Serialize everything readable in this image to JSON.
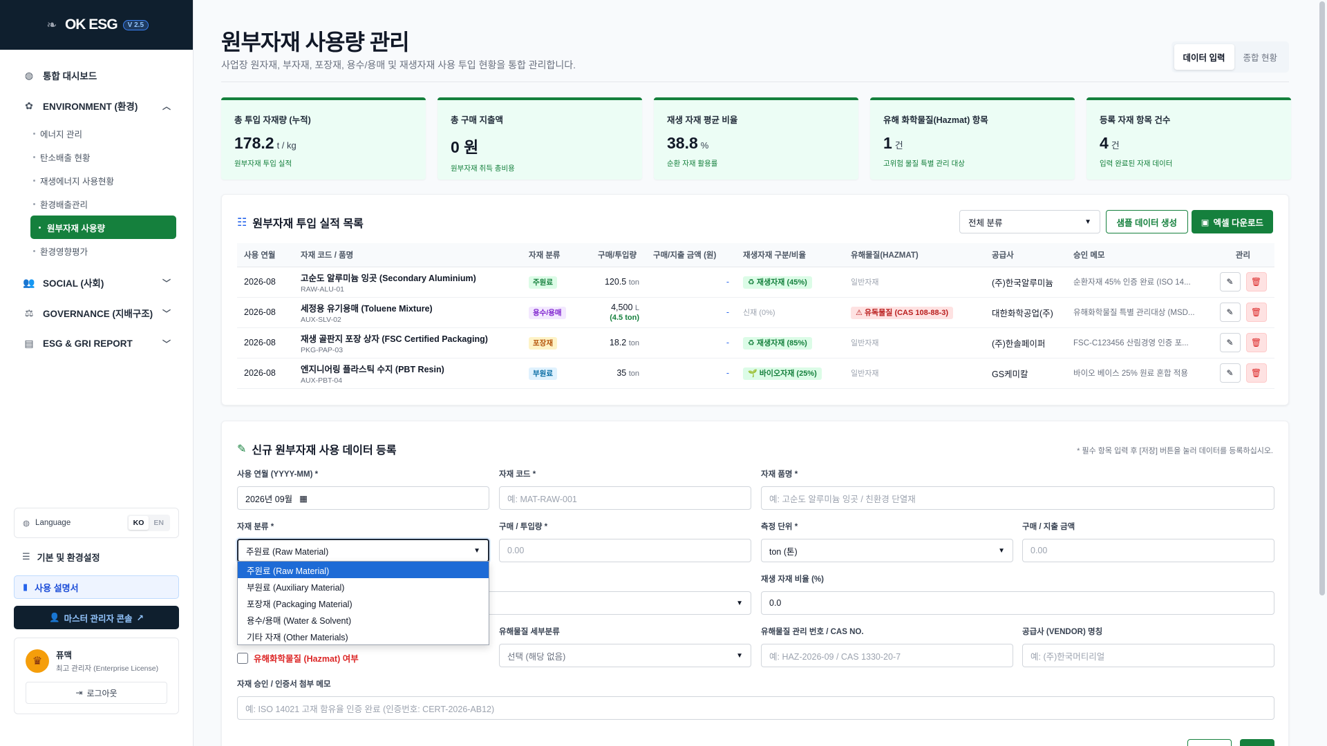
{
  "app": {
    "name": "OK ESG",
    "version": "V 2.5"
  },
  "sidebar": {
    "dashboard": "통합 대시보드",
    "env": {
      "label": "ENVIRONMENT (환경)",
      "items": [
        "에너지 관리",
        "탄소배출 현황",
        "재생에너지 사용현황",
        "환경배출관리",
        "원부자재 사용량",
        "환경영향평가"
      ],
      "active": "원부자재 사용량"
    },
    "social": "SOCIAL (사회)",
    "governance": "GOVERNANCE (지배구조)",
    "report": "ESG & GRI REPORT",
    "language_label": "Language",
    "lang_ko": "KO",
    "lang_en": "EN",
    "settings": "기본 및 환경설정",
    "manual": "사용 설명서",
    "master": "마스터 관리자 콘솔",
    "user_name": "퓨맥",
    "user_role": "최고 관리자 (Enterprise License)",
    "logout": "로그아웃"
  },
  "header": {
    "title": "원부자재 사용량 관리",
    "subtitle": "사업장 원자재, 부자재, 포장재, 용수/용매 및 재생자재 사용 투입 현황을 통합 관리합니다.",
    "tab_input": "데이터 입력",
    "tab_summary": "종합 현황"
  },
  "cards": [
    {
      "label": "총 투입 자재량 (누적)",
      "value": "178.2",
      "unit": "t / kg",
      "desc": "원부자재 투입 실적"
    },
    {
      "label": "총 구매 지출액",
      "value": "0 원",
      "unit": "",
      "desc": "원부자재 취득 총비용"
    },
    {
      "label": "재생 자재 평균 비율",
      "value": "38.8",
      "unit": "%",
      "desc": "순환 자재 활용률"
    },
    {
      "label": "유해 화학물질(Hazmat) 항목",
      "value": "1",
      "unit": "건",
      "desc": "고위험 물질 특별 관리 대상"
    },
    {
      "label": "등록 자재 항목 건수",
      "value": "4",
      "unit": "건",
      "desc": "입력 완료된 자재 데이터"
    }
  ],
  "list": {
    "title": "원부자재 투입 실적 목록",
    "filter": "전체 분류",
    "sample_btn": "샘플 데이터 생성",
    "excel_btn": "엑셀 다운로드",
    "headers": [
      "사용 연월",
      "자재 코드 / 품명",
      "자재 분류",
      "구매/투입량",
      "구매/지출 금액 (원)",
      "재생자재 구분/비율",
      "유해물질(HAZMAT)",
      "공급사",
      "승인 메모",
      "관리"
    ],
    "rows": [
      {
        "month": "2026-08",
        "name": "고순도 알루미늄 잉곳 (Secondary Aluminium)",
        "code": "RAW-ALU-01",
        "cat": "주원료",
        "qty": "120.5",
        "unit": "ton",
        "sub": "",
        "amount": "-",
        "recycle": "♻ 재생자재 (45%)",
        "hazmat": "일반자재",
        "vendor": "(주)한국알루미늄",
        "memo": "순환자재 45% 인증 완료 (ISO 14..."
      },
      {
        "month": "2026-08",
        "name": "세정용 유기용매 (Toluene Mixture)",
        "code": "AUX-SLV-02",
        "cat": "용수/용매",
        "qty": "4,500",
        "unit": "L",
        "sub": "(4.5 ton)",
        "amount": "-",
        "recycle": "신재 (0%)",
        "hazmat": "⚠ 유독물질 (CAS 108-88-3)",
        "vendor": "대한화학공업(주)",
        "memo": "유해화학물질 특별 관리대상 (MSD..."
      },
      {
        "month": "2026-08",
        "name": "재생 골판지 포장 상자 (FSC Certified Packaging)",
        "code": "PKG-PAP-03",
        "cat": "포장재",
        "qty": "18.2",
        "unit": "ton",
        "sub": "",
        "amount": "-",
        "recycle": "♻ 재생자재 (85%)",
        "hazmat": "일반자재",
        "vendor": "(주)한솔페이퍼",
        "memo": "FSC-C123456 산림경영 인증 포..."
      },
      {
        "month": "2026-08",
        "name": "엔지니어링 플라스틱 수지 (PBT Resin)",
        "code": "AUX-PBT-04",
        "cat": "부원료",
        "qty": "35",
        "unit": "ton",
        "sub": "",
        "amount": "-",
        "recycle": "🌱 바이오자재 (25%)",
        "hazmat": "일반자재",
        "vendor": "GS케미칼",
        "memo": "바이오 베이스 25% 원료 혼합 적용"
      }
    ]
  },
  "form": {
    "title": "신규 원부자재 사용 데이터 등록",
    "hint": "* 필수 항목 입력 후 [저장] 버튼을 눌러 데이터를 등록하십시오.",
    "month_label": "사용 연월 (YYYY-MM) *",
    "month_value": "2026년 09월",
    "code_label": "자재 코드 *",
    "code_ph": "예: MAT-RAW-001",
    "name_label": "자재 품명 *",
    "name_ph": "예: 고순도 알루미늄 잉곳 / 친환경 단열재",
    "cat_label": "자재 분류 *",
    "cat_value": "주원료 (Raw Material)",
    "cat_options": [
      "주원료 (Raw Material)",
      "부원료 (Auxiliary Material)",
      "포장재 (Packaging Material)",
      "용수/용매 (Water & Solvent)",
      "기타 자재 (Other Materials)"
    ],
    "qty_label": "구매 / 투입량 *",
    "qty_ph": "0.00",
    "unit_label": "측정 단위 *",
    "unit_value": "ton (톤)",
    "amount_label": "구매 / 지출 금액",
    "amount_ph": "0.00",
    "ratio_label": "재생 자재 비율 (%)",
    "ratio_value": "0.0",
    "hazmat_chk": "유해화학물질 (Hazmat) 여부",
    "hazsub_label": "유해물질 세부분류",
    "hazsub_value": "선택 (해당 없음)",
    "cas_label": "유해물질 관리 번호 / CAS NO.",
    "cas_ph": "예: HAZ-2026-09 / CAS 1330-20-7",
    "vendor_label": "공급사 (VENDOR) 명칭",
    "vendor_ph": "예: (주)한국머티리얼",
    "memo_label": "자재 승인 / 인증서 첨부 메모",
    "memo_ph": "예: ISO 14021 고재 함유율 인증 완료 (인증번호: CERT-2026-AB12)"
  },
  "colors": {
    "brand": "#15803d",
    "dark": "#0f1f2e",
    "danger": "#dc2626"
  }
}
